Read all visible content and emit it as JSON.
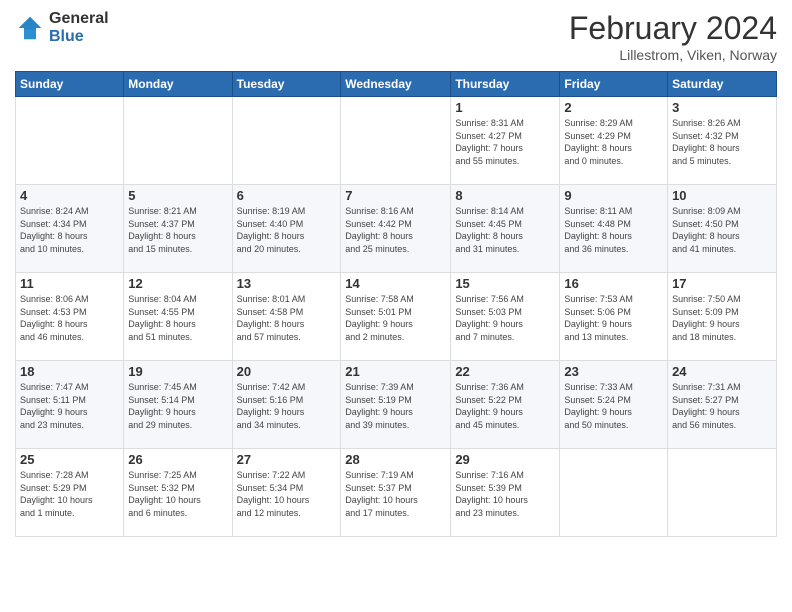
{
  "header": {
    "logo_general": "General",
    "logo_blue": "Blue",
    "title": "February 2024",
    "location": "Lillestrom, Viken, Norway"
  },
  "weekdays": [
    "Sunday",
    "Monday",
    "Tuesday",
    "Wednesday",
    "Thursday",
    "Friday",
    "Saturday"
  ],
  "weeks": [
    [
      {
        "day": "",
        "info": ""
      },
      {
        "day": "",
        "info": ""
      },
      {
        "day": "",
        "info": ""
      },
      {
        "day": "",
        "info": ""
      },
      {
        "day": "1",
        "info": "Sunrise: 8:31 AM\nSunset: 4:27 PM\nDaylight: 7 hours\nand 55 minutes."
      },
      {
        "day": "2",
        "info": "Sunrise: 8:29 AM\nSunset: 4:29 PM\nDaylight: 8 hours\nand 0 minutes."
      },
      {
        "day": "3",
        "info": "Sunrise: 8:26 AM\nSunset: 4:32 PM\nDaylight: 8 hours\nand 5 minutes."
      }
    ],
    [
      {
        "day": "4",
        "info": "Sunrise: 8:24 AM\nSunset: 4:34 PM\nDaylight: 8 hours\nand 10 minutes."
      },
      {
        "day": "5",
        "info": "Sunrise: 8:21 AM\nSunset: 4:37 PM\nDaylight: 8 hours\nand 15 minutes."
      },
      {
        "day": "6",
        "info": "Sunrise: 8:19 AM\nSunset: 4:40 PM\nDaylight: 8 hours\nand 20 minutes."
      },
      {
        "day": "7",
        "info": "Sunrise: 8:16 AM\nSunset: 4:42 PM\nDaylight: 8 hours\nand 25 minutes."
      },
      {
        "day": "8",
        "info": "Sunrise: 8:14 AM\nSunset: 4:45 PM\nDaylight: 8 hours\nand 31 minutes."
      },
      {
        "day": "9",
        "info": "Sunrise: 8:11 AM\nSunset: 4:48 PM\nDaylight: 8 hours\nand 36 minutes."
      },
      {
        "day": "10",
        "info": "Sunrise: 8:09 AM\nSunset: 4:50 PM\nDaylight: 8 hours\nand 41 minutes."
      }
    ],
    [
      {
        "day": "11",
        "info": "Sunrise: 8:06 AM\nSunset: 4:53 PM\nDaylight: 8 hours\nand 46 minutes."
      },
      {
        "day": "12",
        "info": "Sunrise: 8:04 AM\nSunset: 4:55 PM\nDaylight: 8 hours\nand 51 minutes."
      },
      {
        "day": "13",
        "info": "Sunrise: 8:01 AM\nSunset: 4:58 PM\nDaylight: 8 hours\nand 57 minutes."
      },
      {
        "day": "14",
        "info": "Sunrise: 7:58 AM\nSunset: 5:01 PM\nDaylight: 9 hours\nand 2 minutes."
      },
      {
        "day": "15",
        "info": "Sunrise: 7:56 AM\nSunset: 5:03 PM\nDaylight: 9 hours\nand 7 minutes."
      },
      {
        "day": "16",
        "info": "Sunrise: 7:53 AM\nSunset: 5:06 PM\nDaylight: 9 hours\nand 13 minutes."
      },
      {
        "day": "17",
        "info": "Sunrise: 7:50 AM\nSunset: 5:09 PM\nDaylight: 9 hours\nand 18 minutes."
      }
    ],
    [
      {
        "day": "18",
        "info": "Sunrise: 7:47 AM\nSunset: 5:11 PM\nDaylight: 9 hours\nand 23 minutes."
      },
      {
        "day": "19",
        "info": "Sunrise: 7:45 AM\nSunset: 5:14 PM\nDaylight: 9 hours\nand 29 minutes."
      },
      {
        "day": "20",
        "info": "Sunrise: 7:42 AM\nSunset: 5:16 PM\nDaylight: 9 hours\nand 34 minutes."
      },
      {
        "day": "21",
        "info": "Sunrise: 7:39 AM\nSunset: 5:19 PM\nDaylight: 9 hours\nand 39 minutes."
      },
      {
        "day": "22",
        "info": "Sunrise: 7:36 AM\nSunset: 5:22 PM\nDaylight: 9 hours\nand 45 minutes."
      },
      {
        "day": "23",
        "info": "Sunrise: 7:33 AM\nSunset: 5:24 PM\nDaylight: 9 hours\nand 50 minutes."
      },
      {
        "day": "24",
        "info": "Sunrise: 7:31 AM\nSunset: 5:27 PM\nDaylight: 9 hours\nand 56 minutes."
      }
    ],
    [
      {
        "day": "25",
        "info": "Sunrise: 7:28 AM\nSunset: 5:29 PM\nDaylight: 10 hours\nand 1 minute."
      },
      {
        "day": "26",
        "info": "Sunrise: 7:25 AM\nSunset: 5:32 PM\nDaylight: 10 hours\nand 6 minutes."
      },
      {
        "day": "27",
        "info": "Sunrise: 7:22 AM\nSunset: 5:34 PM\nDaylight: 10 hours\nand 12 minutes."
      },
      {
        "day": "28",
        "info": "Sunrise: 7:19 AM\nSunset: 5:37 PM\nDaylight: 10 hours\nand 17 minutes."
      },
      {
        "day": "29",
        "info": "Sunrise: 7:16 AM\nSunset: 5:39 PM\nDaylight: 10 hours\nand 23 minutes."
      },
      {
        "day": "",
        "info": ""
      },
      {
        "day": "",
        "info": ""
      }
    ]
  ]
}
